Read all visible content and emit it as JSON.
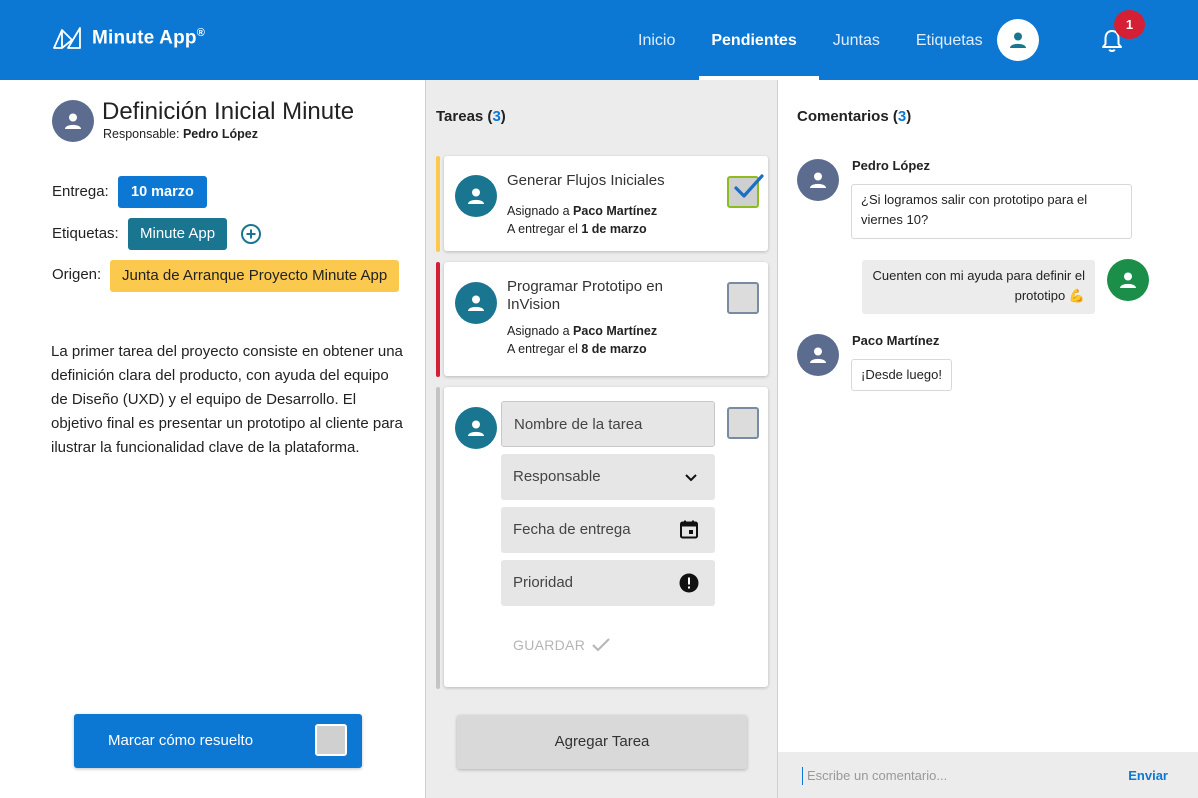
{
  "app": {
    "name": "Minute App",
    "trademark": "®"
  },
  "nav": {
    "items": [
      {
        "label": "Inicio",
        "active": false
      },
      {
        "label": "Pendientes",
        "active": true
      },
      {
        "label": "Juntas",
        "active": false
      },
      {
        "label": "Etiquetas",
        "active": false
      }
    ],
    "notifications_count": "1"
  },
  "detail": {
    "title": "Definición Inicial Minute",
    "responsable_label": "Responsable:",
    "responsable_name": "Pedro López",
    "entrega_label": "Entrega:",
    "entrega_value": "10 marzo",
    "etiquetas_label": "Etiquetas:",
    "etiqueta_value": "Minute App",
    "origen_label": "Origen:",
    "origen_value": "Junta de Arranque Proyecto Minute App",
    "description": "La primer tarea del proyecto consiste en obtener una definición clara del producto, con ayuda del equipo de Diseño (UXD) y el equipo de Desarrollo. El objetivo final es presentar un prototipo al cliente para ilustrar la funcionalidad clave de la plataforma.",
    "resolve_label": "Marcar cómo resuelto"
  },
  "tasks": {
    "title": "Tareas",
    "count": "3",
    "items": [
      {
        "title": "Generar Flujos Iniciales",
        "assigned_label": "Asignado a",
        "assignee": "Paco Martínez",
        "due_label": "A entregar el",
        "due": "1 de marzo",
        "done": true,
        "priority_color": "#fbc94e"
      },
      {
        "title": "Programar Prototipo en InVision",
        "assigned_label": "Asignado a",
        "assignee": "Paco Martínez",
        "due_label": "A entregar el",
        "due": "8 de marzo",
        "done": false,
        "priority_color": "#d51f34"
      }
    ],
    "new_task": {
      "name_placeholder": "Nombre de la tarea",
      "responsable_placeholder": "Responsable",
      "date_placeholder": "Fecha de entrega",
      "priority_placeholder": "Prioridad",
      "save_label": "GUARDAR"
    },
    "add_label": "Agregar Tarea"
  },
  "comments": {
    "title": "Comentarios",
    "count": "3",
    "items": [
      {
        "author": "Pedro López",
        "text": "¿Si logramos salir con prototipo para el viernes 10?"
      },
      {
        "author": "",
        "text_line1": "Cuenten con mi ayuda para definir el",
        "text_line2": "prototipo 💪"
      },
      {
        "author": "Paco Martínez",
        "text": "¡Desde luego!"
      }
    ],
    "input_placeholder": "Escribe un comentario...",
    "send_label": "Enviar"
  },
  "colors": {
    "primary": "#0d78d3",
    "teal": "#1a7590",
    "yellow": "#fbc94e",
    "red": "#d51f34",
    "green": "#1b8e4a"
  }
}
